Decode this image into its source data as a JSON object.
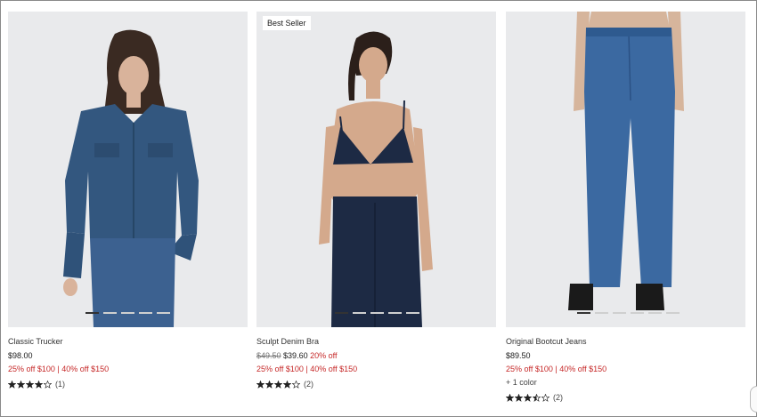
{
  "products": [
    {
      "name": "Classic Trucker",
      "price": "$98.00",
      "promo": "25% off $100 | 40% off $150",
      "rating": 4,
      "rating_count": "(1)",
      "dots_total": 5,
      "dots_active": 0
    },
    {
      "badge": "Best Seller",
      "name": "Sculpt Denim Bra",
      "original_price": "$49.50",
      "sale_price": "$39.60",
      "discount": "20% off",
      "promo": "25% off $100 | 40% off $150",
      "rating": 4,
      "rating_count": "(2)",
      "dots_total": 5,
      "dots_active": 0
    },
    {
      "name": "Original Bootcut Jeans",
      "price": "$89.50",
      "promo": "25% off $100 | 40% off $150",
      "colors_note": "+ 1 color",
      "rating": 3.5,
      "rating_count": "(2)",
      "dots_total": 6,
      "dots_active": 0
    }
  ],
  "colors": {
    "promo_red": "#c62828",
    "denim": "#33577f",
    "denim_dark": "#1d2a44",
    "background": "#e9eaec"
  }
}
